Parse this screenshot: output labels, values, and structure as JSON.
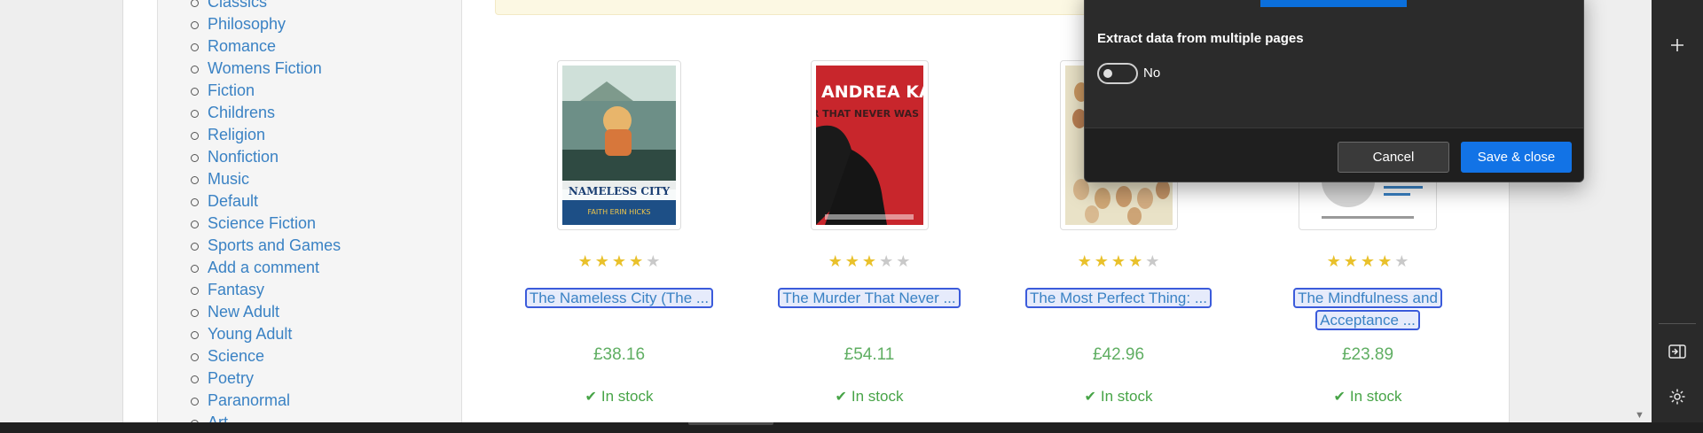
{
  "sidebar": {
    "categories": [
      "Classics",
      "Philosophy",
      "Romance",
      "Womens Fiction",
      "Fiction",
      "Childrens",
      "Religion",
      "Nonfiction",
      "Music",
      "Default",
      "Science Fiction",
      "Sports and Games",
      "Add a comment",
      "Fantasy",
      "New Adult",
      "Young Adult",
      "Science",
      "Poetry",
      "Paranormal",
      "Art"
    ]
  },
  "products": [
    {
      "title": "The Nameless City (The ...",
      "price": "£38.16",
      "stock": "In stock",
      "rating": 4,
      "cover_color": "#4b7aa6"
    },
    {
      "title": "The Murder That Never ...",
      "price": "£54.11",
      "stock": "In stock",
      "rating": 3,
      "cover_color": "#c8262c",
      "cover_text": "ANDREA KANE",
      "cover_text_2": "THE MURDER THAT NEVER WAS"
    },
    {
      "title": "The Most Perfect Thing: ...",
      "price": "£42.96",
      "stock": "In stock",
      "rating": 4,
      "cover_color": "#e9e2c7"
    },
    {
      "title": "The Mindfulness and Acceptance ...",
      "price": "£23.89",
      "stock": "In stock",
      "rating": 4,
      "cover_color": "#ffffff"
    }
  ],
  "modal": {
    "heading": "Extract data from multiple pages",
    "toggle_label": "No",
    "cancel_label": "Cancel",
    "save_label": "Save & close"
  },
  "icons": {
    "plus": "plus-icon",
    "sidebar": "sidebar-toggle-icon",
    "settings": "gear-icon",
    "check": "check-icon",
    "chevron": "chevron-down-icon"
  },
  "colors": {
    "link": "#3a82c4",
    "price": "#5fae62",
    "stock": "#47a447",
    "star": "#e9c12b",
    "primary_button": "#1273e6",
    "selection": "#3b5bdb"
  }
}
